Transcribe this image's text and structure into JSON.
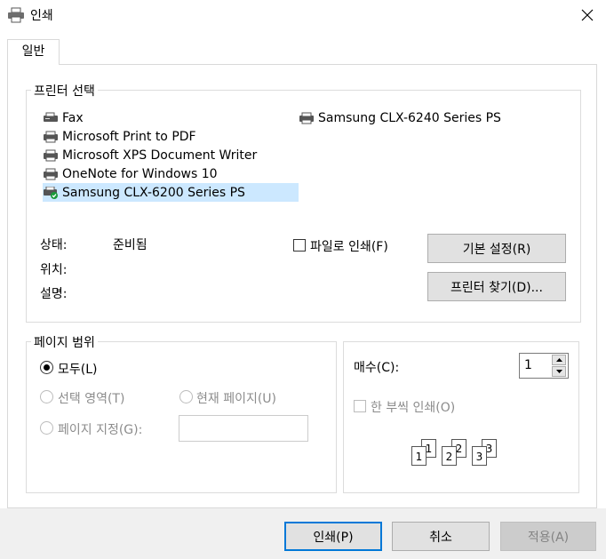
{
  "window": {
    "title": "인쇄"
  },
  "tabs": [
    {
      "label": "일반"
    }
  ],
  "printer_select": {
    "group_label": "프린터 선택",
    "printers": [
      {
        "name": "Fax",
        "icon": "fax-icon"
      },
      {
        "name": "Microsoft Print to PDF",
        "icon": "printer-icon"
      },
      {
        "name": "Microsoft XPS Document Writer",
        "icon": "printer-icon"
      },
      {
        "name": "OneNote for Windows 10",
        "icon": "printer-icon"
      },
      {
        "name": "Samsung CLX-6200 Series PS",
        "icon": "default-printer-icon",
        "selected": true
      },
      {
        "name": "Samsung CLX-6240 Series PS",
        "icon": "printer-icon"
      }
    ],
    "status_label": "상태:",
    "status_value": "준비됨",
    "location_label": "위치:",
    "comment_label": "설명:",
    "print_to_file_label": "파일로 인쇄(F)",
    "preferences_button": "기본 설정(R)",
    "find_printer_button": "프린터 찾기(D)..."
  },
  "page_range": {
    "group_label": "페이지 범위",
    "all_label": "모두(L)",
    "selection_label": "선택 영역(T)",
    "current_page_label": "현재 페이지(U)",
    "pages_label": "페이지 지정(G):",
    "pages_value": ""
  },
  "copies": {
    "label": "매수(C):",
    "value": "1",
    "collate_label": "한 부씩 인쇄(O)",
    "collate_digits": [
      "1",
      "1",
      "2",
      "2",
      "3",
      "3"
    ]
  },
  "footer": {
    "print_button": "인쇄(P)",
    "cancel_button": "취소",
    "apply_button": "적용(A)"
  },
  "colors": {
    "selection": "#cce8ff",
    "accent": "#0078d7",
    "footer_bg": "#f0f0f0"
  }
}
